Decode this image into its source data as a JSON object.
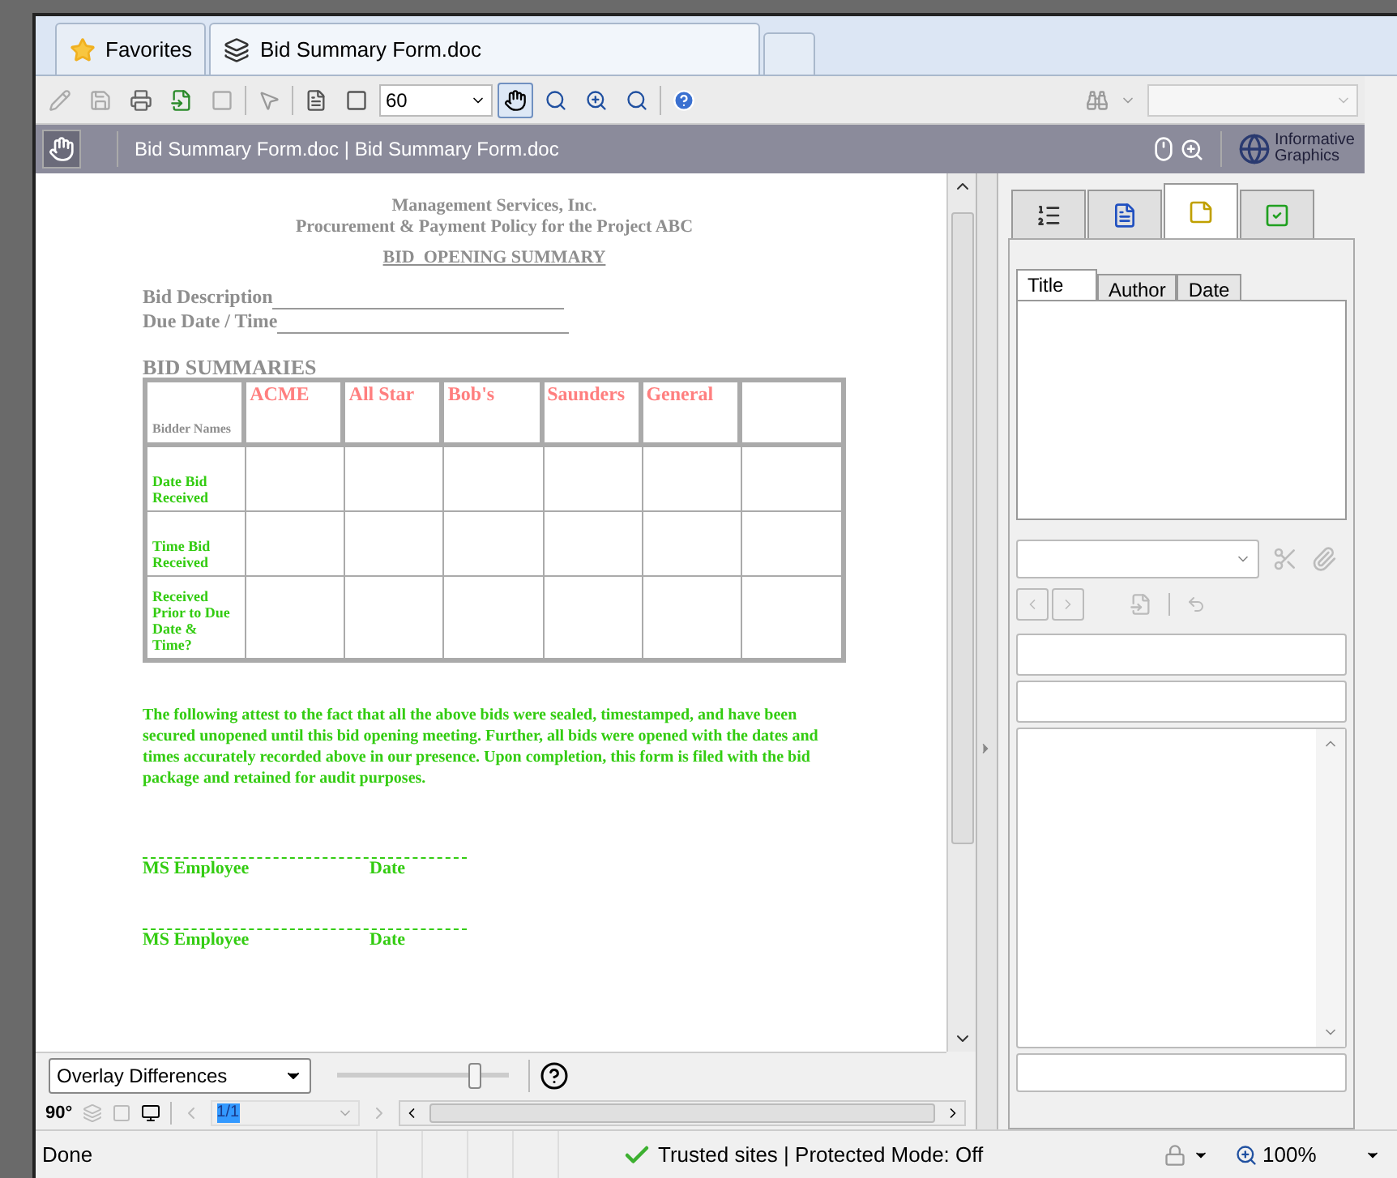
{
  "browser_tabs": [
    {
      "label": "Favorites",
      "kind": "favorites",
      "selected": false
    },
    {
      "label": "Bid Summary Form.doc",
      "kind": "document",
      "selected": true
    },
    {
      "kind": "new",
      "selected": false
    }
  ],
  "toolbar": {
    "zoom_value": "60"
  },
  "viewer_title": "Bid Summary Form.doc | Bid Summary Form.doc",
  "brand": {
    "line1": "Informative",
    "line2": "Graphics"
  },
  "document": {
    "company": "Management Services, Inc.",
    "policy": "Procurement & Payment Policy for the Project ABC",
    "heading": "BID  OPENING SUMMARY",
    "fields": [
      "Bid Description",
      "Due Date / Time"
    ],
    "section": "BID SUMMARIES",
    "table": {
      "corner": "Bidder Names",
      "bidders": [
        "ACME",
        "All Star",
        "Bob's",
        "Saunders",
        "General"
      ],
      "rows": [
        "Date Bid Received",
        "Time Bid Received",
        "Received Prior to Due Date & Time?"
      ]
    },
    "statement": "The following attest to the fact that all the above bids were sealed, timestamped, and have been secured unopened until this bid opening meeting.  Further, all bids were opened with the dates and times accurately recorded above in our presence. Upon completion, this form is filed with the bid package and retained for audit purposes.",
    "signatures": [
      {
        "name": "MS Employee",
        "date": "Date"
      },
      {
        "name": "MS Employee",
        "date": "Date"
      }
    ]
  },
  "bottom_bar": {
    "mode": "Overlay Differences",
    "level": 0.8,
    "rotate": "90°",
    "page": "1/1"
  },
  "panel": {
    "tabs": [
      {
        "kind": "list",
        "selected": false
      },
      {
        "kind": "notes",
        "selected": false
      },
      {
        "kind": "markup",
        "selected": true
      },
      {
        "kind": "check",
        "selected": false
      }
    ],
    "columns": [
      {
        "label": "Title",
        "selected": true
      },
      {
        "label": "Author",
        "selected": false
      },
      {
        "label": "Date",
        "selected": false
      }
    ]
  },
  "status_bar": {
    "text": "Done",
    "zone": "Trusted sites | Protected Mode: Off",
    "zoom": "100%"
  }
}
